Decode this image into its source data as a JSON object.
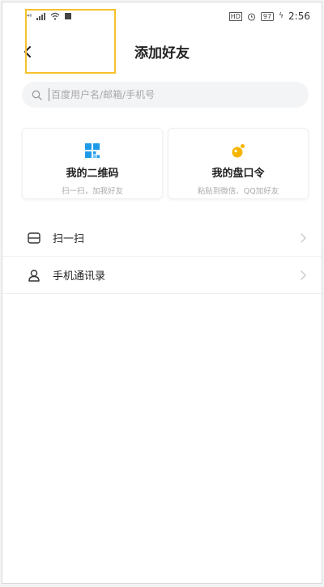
{
  "status_bar": {
    "time": "2:56",
    "signal_label": "⁴⁶",
    "hd_label": "HD",
    "battery_label": "97"
  },
  "header": {
    "title": "添加好友"
  },
  "search": {
    "placeholder": "百度用户名/邮箱/手机号",
    "value": ""
  },
  "cards": [
    {
      "title": "我的二维码",
      "subtitle": "扫一扫，加我好友",
      "icon": "qr-code-icon",
      "accent": "#1e9be8"
    },
    {
      "title": "我的盘口令",
      "subtitle": "粘贴到微信、QQ加好友",
      "icon": "pan-token-icon",
      "accent": "#f7b500"
    }
  ],
  "list": [
    {
      "label": "扫一扫",
      "icon": "scan-icon"
    },
    {
      "label": "手机通讯录",
      "icon": "contacts-icon"
    }
  ],
  "colors": {
    "highlight": "#f7c12b",
    "blue": "#1e9be8",
    "orange": "#f7b500"
  }
}
